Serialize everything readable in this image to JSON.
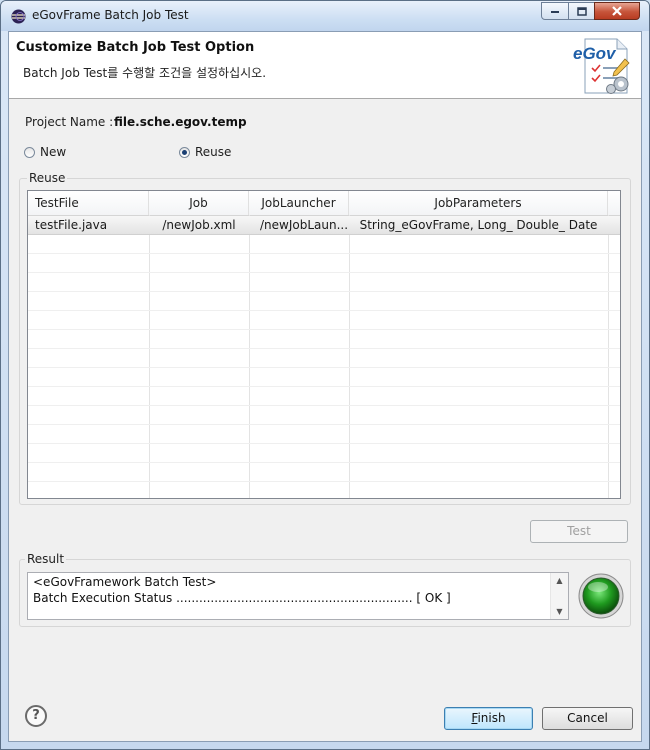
{
  "window": {
    "title": "eGovFrame Batch Job Test",
    "icon": "eclipse-icon"
  },
  "window_controls": {
    "minimize": "minimize-icon",
    "maximize": "maximize-icon",
    "close": "close-icon"
  },
  "header": {
    "title": "Customize Batch Job Test Option",
    "description": "Batch Job Test를 수행할 조건을 설정하십시오.",
    "logo_text": "eGov"
  },
  "project": {
    "label": "Project Name :",
    "value": "file.sche.egov.temp"
  },
  "mode": {
    "options": [
      {
        "label": "New",
        "selected": false
      },
      {
        "label": "Reuse",
        "selected": true
      }
    ]
  },
  "reuse_group": {
    "label": "Reuse",
    "columns": [
      "TestFile",
      "Job",
      "JobLauncher",
      "JobParameters"
    ],
    "rows": [
      [
        "testFile.java",
        "/newJob.xml",
        "/newJobLaun...",
        "String_eGovFrame, Long_ Double_ Date"
      ]
    ]
  },
  "test_button": {
    "label": "Test",
    "enabled": false
  },
  "result_group": {
    "label": "Result",
    "lines": [
      "<eGovFramework Batch Test>",
      "Batch Execution Status .............................................................. [ OK ]"
    ],
    "status_color": "#1f9a1f"
  },
  "footer": {
    "help_icon": "help-icon",
    "finish_prefix": "",
    "finish_mnemonic": "F",
    "finish_rest": "inish",
    "cancel_label": "Cancel"
  }
}
